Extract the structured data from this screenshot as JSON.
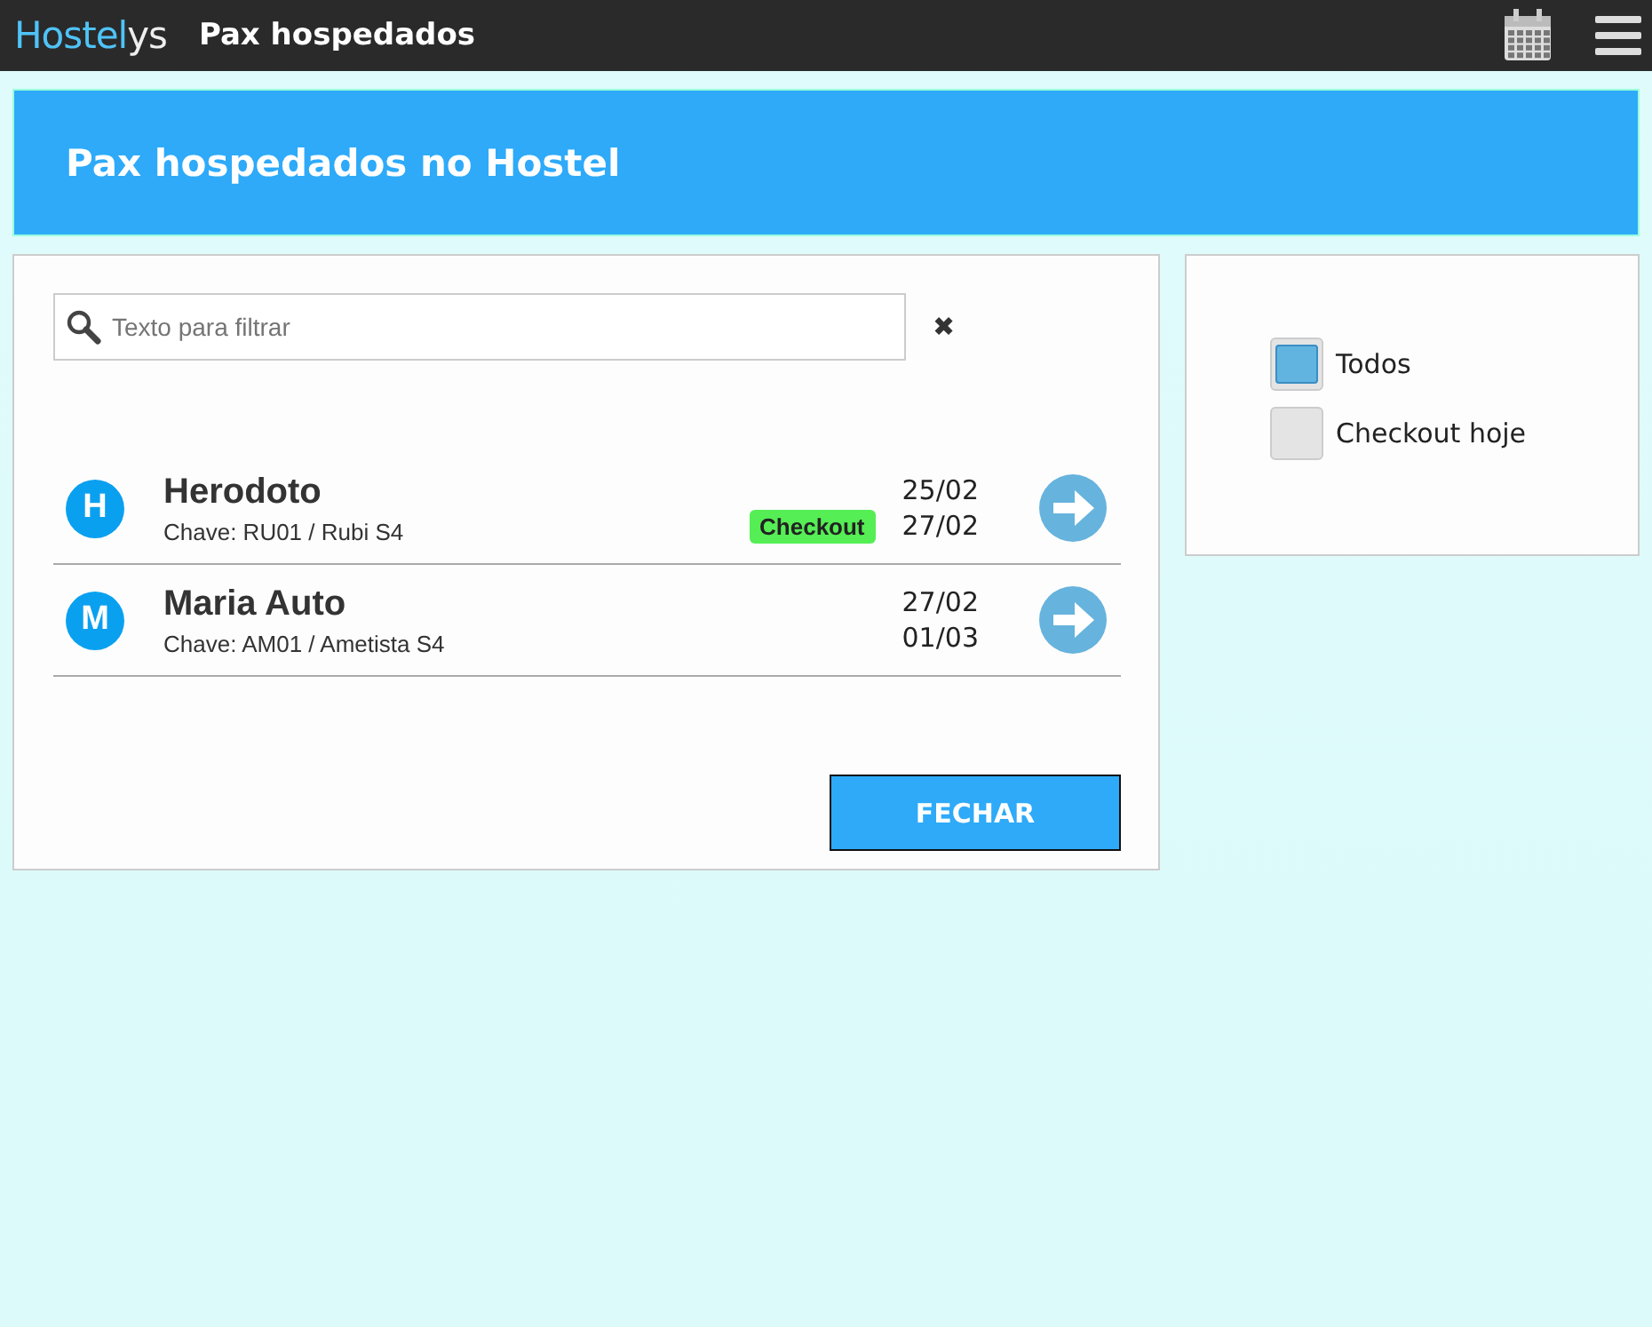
{
  "header": {
    "logo": {
      "main": "Hostel",
      "suffix": "ys"
    },
    "title": "Pax hospedados"
  },
  "banner": {
    "title": "Pax hospedados no Hostel"
  },
  "search": {
    "placeholder": "Texto para filtrar",
    "clear": "✖"
  },
  "guests": [
    {
      "initial": "H",
      "name": "Herodoto",
      "key": "Chave: RU01 / Rubi S4",
      "badge": "Checkout",
      "checkin": "25/02",
      "checkout": "27/02"
    },
    {
      "initial": "M",
      "name": "Maria Auto",
      "key": "Chave: AM01 / Ametista S4",
      "checkin": "27/02",
      "checkout": "01/03"
    }
  ],
  "close_button": "FECHAR",
  "filters": [
    {
      "label": "Todos",
      "selected": true
    },
    {
      "label": "Checkout hoje",
      "selected": false
    }
  ]
}
